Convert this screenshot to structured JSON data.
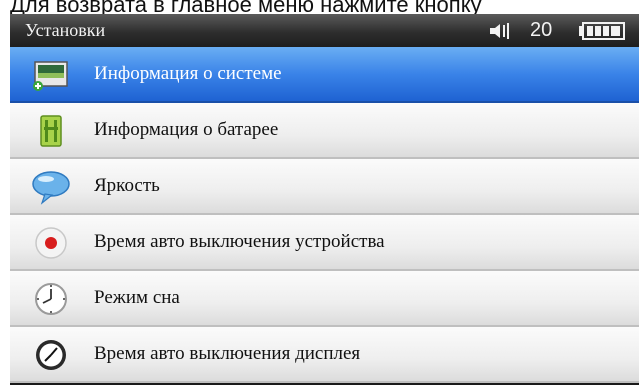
{
  "caption": "Для возврата в главное меню нажмите кнопку",
  "statusbar": {
    "title": "Установки",
    "volume_icon": "speaker-icon",
    "volume_level": "20",
    "battery_icon": "battery-full-icon"
  },
  "menu": {
    "selected_index": 0,
    "items": [
      {
        "label": "Информация о системе",
        "icon": "system-info-icon"
      },
      {
        "label": "Информация о батарее",
        "icon": "battery-info-icon"
      },
      {
        "label": "Яркость",
        "icon": "brightness-bubble-icon"
      },
      {
        "label": "Время авто выключения устройства",
        "icon": "record-dot-icon"
      },
      {
        "label": "Режим сна",
        "icon": "clock-icon"
      },
      {
        "label": "Время авто выключения дисплея",
        "icon": "timer-icon"
      }
    ]
  },
  "colors": {
    "selection": "#3a83e8",
    "header": "#2e2e2e",
    "row": "#eeeeee"
  }
}
